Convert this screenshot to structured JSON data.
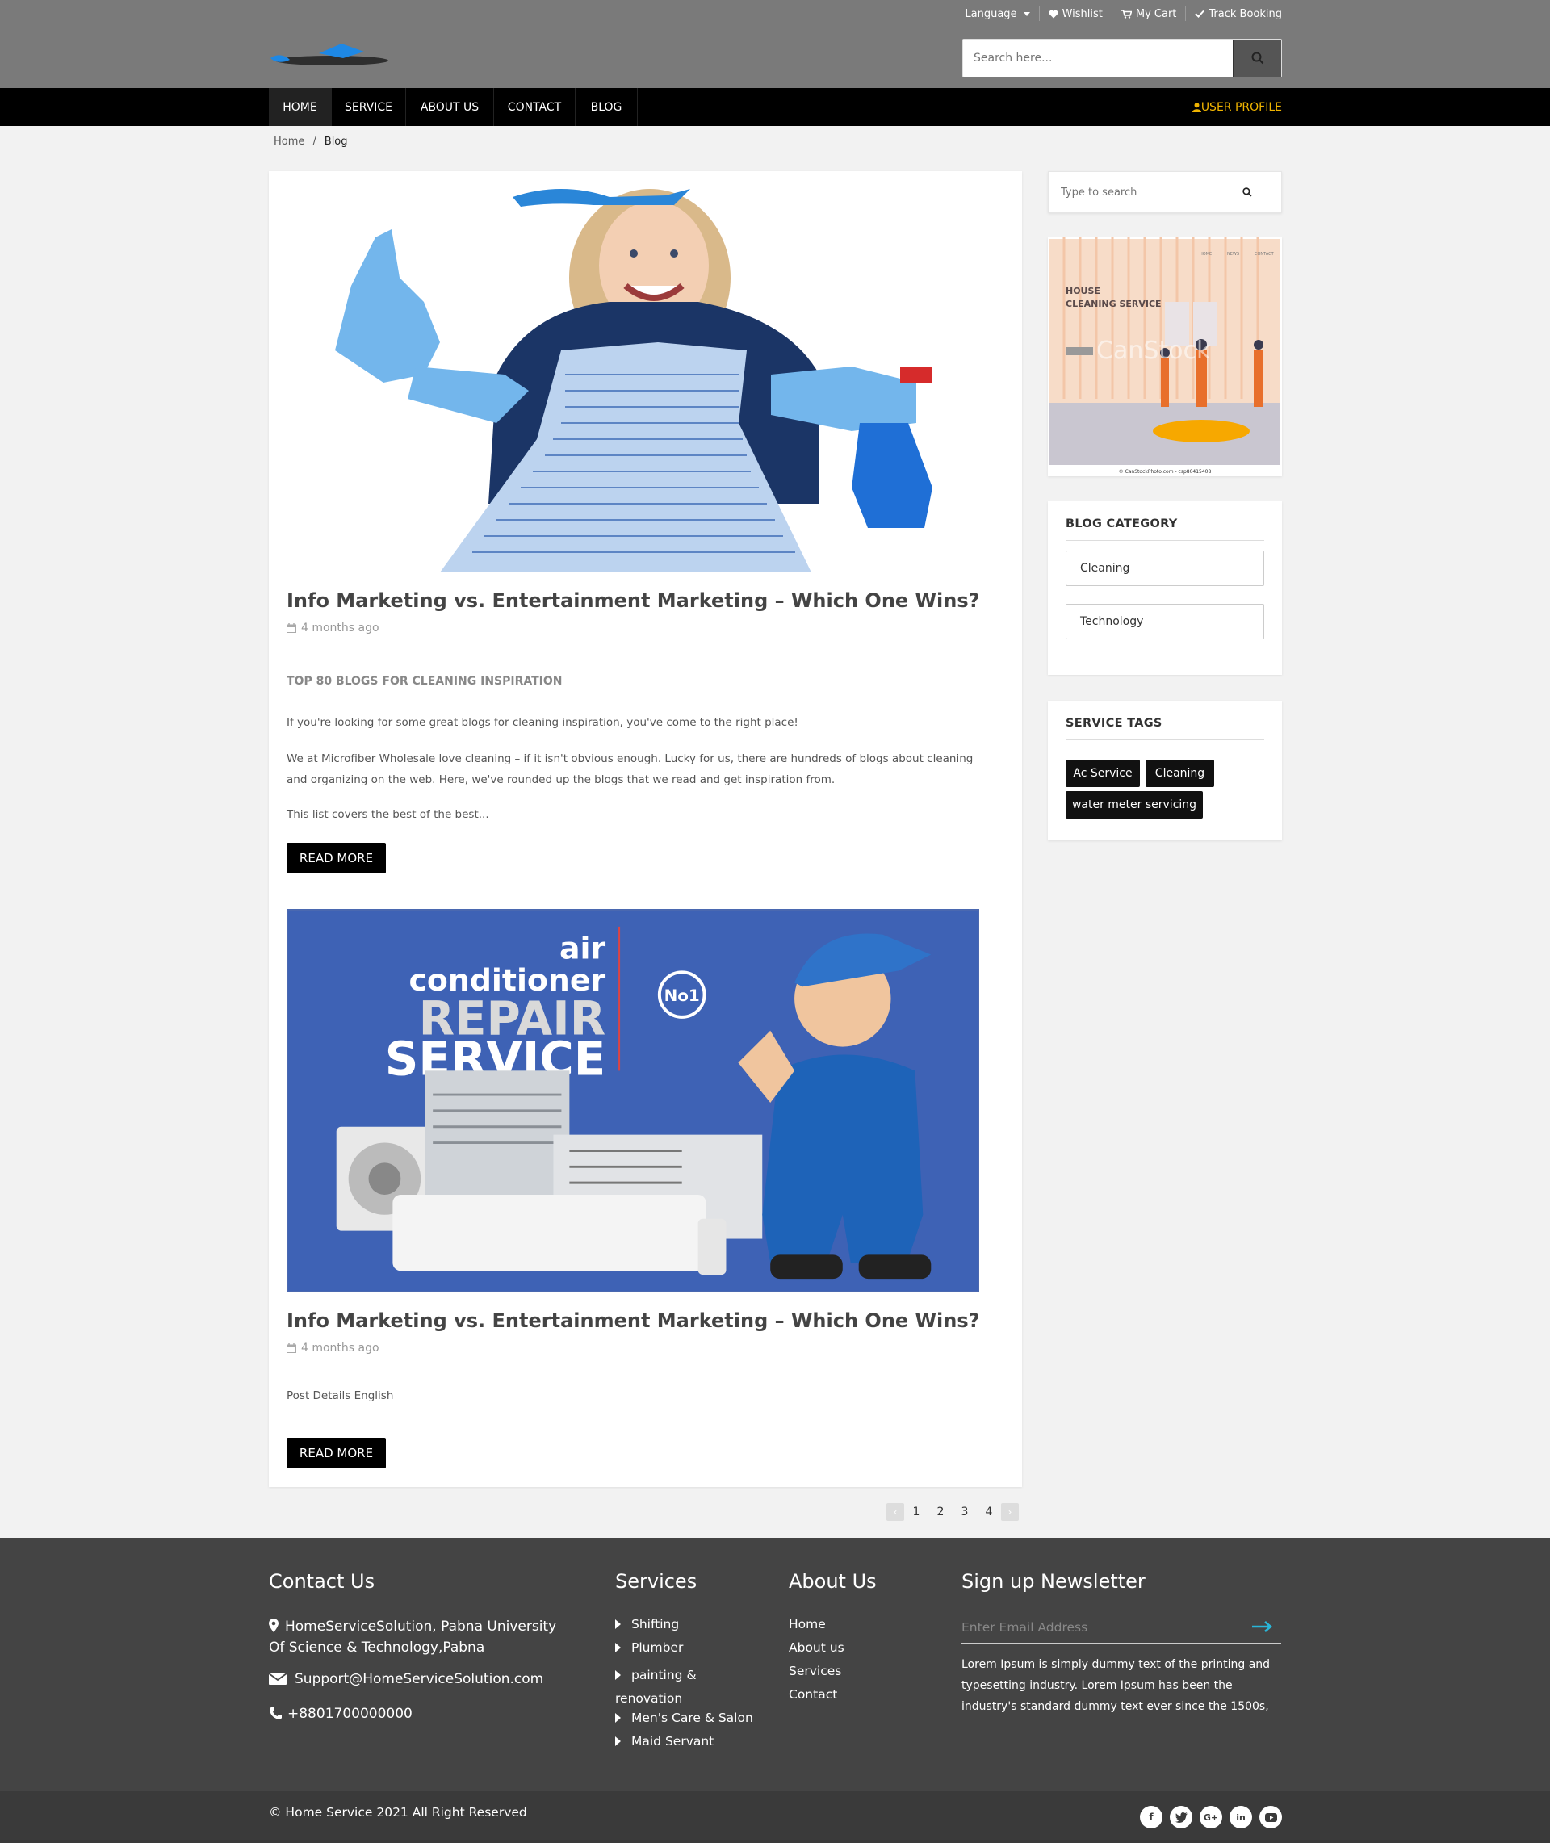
{
  "header": {
    "top_links": [
      {
        "label": "Language",
        "icon": "caret-down-icon"
      },
      {
        "label": "Wishlist",
        "icon": "heart-icon"
      },
      {
        "label": "My Cart",
        "icon": "cart-icon"
      },
      {
        "label": "Track Booking",
        "icon": "check-icon"
      }
    ],
    "search_placeholder": "Search here..."
  },
  "nav": {
    "items": [
      "HOME",
      "SERVICE",
      "ABOUT US",
      "CONTACT",
      "BLOG"
    ],
    "active": "HOME",
    "user_profile": "USER PROFILE"
  },
  "breadcrumb": {
    "home": "Home",
    "separator": "/",
    "current": "Blog"
  },
  "posts": [
    {
      "image": "woman-cleaning-illustration",
      "title": "Info Marketing vs. Entertainment Marketing – Which One Wins?",
      "date": "4 months ago",
      "subtitle": "TOP 80 BLOGS FOR CLEANING INSPIRATION",
      "paragraphs": [
        "If you're looking for some great blogs for cleaning inspiration, you've come to the right place!",
        "We at Microfiber Wholesale love cleaning – if it isn't obvious enough. Lucky for us, there are hundreds of blogs about cleaning and organizing on the web. Here, we've rounded up the blogs that we read and get inspiration from.",
        "This list covers the best of the best..."
      ],
      "button": "READ MORE"
    },
    {
      "image": "air-conditioner-repair-banner",
      "banner_text": {
        "line1": "air",
        "line2": "conditioner",
        "line3": "REPAIR",
        "line4": "SERVICE",
        "badge": "No1"
      },
      "title": "Info Marketing vs. Entertainment Marketing – Which One Wins?",
      "date": "4 months ago",
      "paragraphs": [
        "Post Details English"
      ],
      "button": "READ MORE"
    }
  ],
  "pagination": {
    "pages": [
      "1",
      "2",
      "3",
      "4"
    ],
    "prev": "‹",
    "next": "›"
  },
  "sidebar": {
    "search_placeholder": "Type to search",
    "ad": {
      "title_line1": "HOUSE",
      "title_line2": "CLEANING SERVICE",
      "nav": [
        "HOME",
        "NEWS",
        "CONTACT"
      ],
      "watermark": "CanStock",
      "credit": "© CanStockPhoto.com - csp80415408"
    },
    "blog_category": {
      "title": "BLOG CATEGORY",
      "items": [
        "Cleaning",
        "Technology"
      ]
    },
    "service_tags": {
      "title": "SERVICE TAGS",
      "items": [
        "Ac Service",
        "Cleaning",
        "water meter servicing"
      ]
    }
  },
  "footer": {
    "contact": {
      "title": "Contact Us",
      "address": "HomeServiceSolution, Pabna University Of Science & Technology,Pabna",
      "email": "Support@HomeServiceSolution.com",
      "phone": "+8801700000000"
    },
    "services": {
      "title": "Services",
      "items": [
        "Shifting",
        "Plumber",
        "painting & renovation",
        "Men's Care & Salon",
        "Maid Servant"
      ]
    },
    "about": {
      "title": "About Us",
      "items": [
        "Home",
        "About us",
        "Services",
        "Contact"
      ]
    },
    "newsletter": {
      "title": "Sign up Newsletter",
      "placeholder": "Enter Email Address",
      "text": "Lorem Ipsum is simply dummy text of the printing and typesetting industry. Lorem Ipsum has been the industry's standard dummy text ever since the 1500s,"
    },
    "copyright": "© Home Service 2021 All Right Reserved",
    "social": [
      "facebook-icon",
      "twitter-icon",
      "google-plus-icon",
      "linkedin-icon",
      "youtube-icon"
    ],
    "social_glyphs": {
      "facebook": "f",
      "google": "G+",
      "linkedin": "in"
    }
  },
  "colors": {
    "nav_bg": "#000000",
    "topbar_bg": "#7a7a7a",
    "accent": "#f0b400",
    "footer_bg": "#444444",
    "newsletter_arrow": "#29b6d8"
  }
}
